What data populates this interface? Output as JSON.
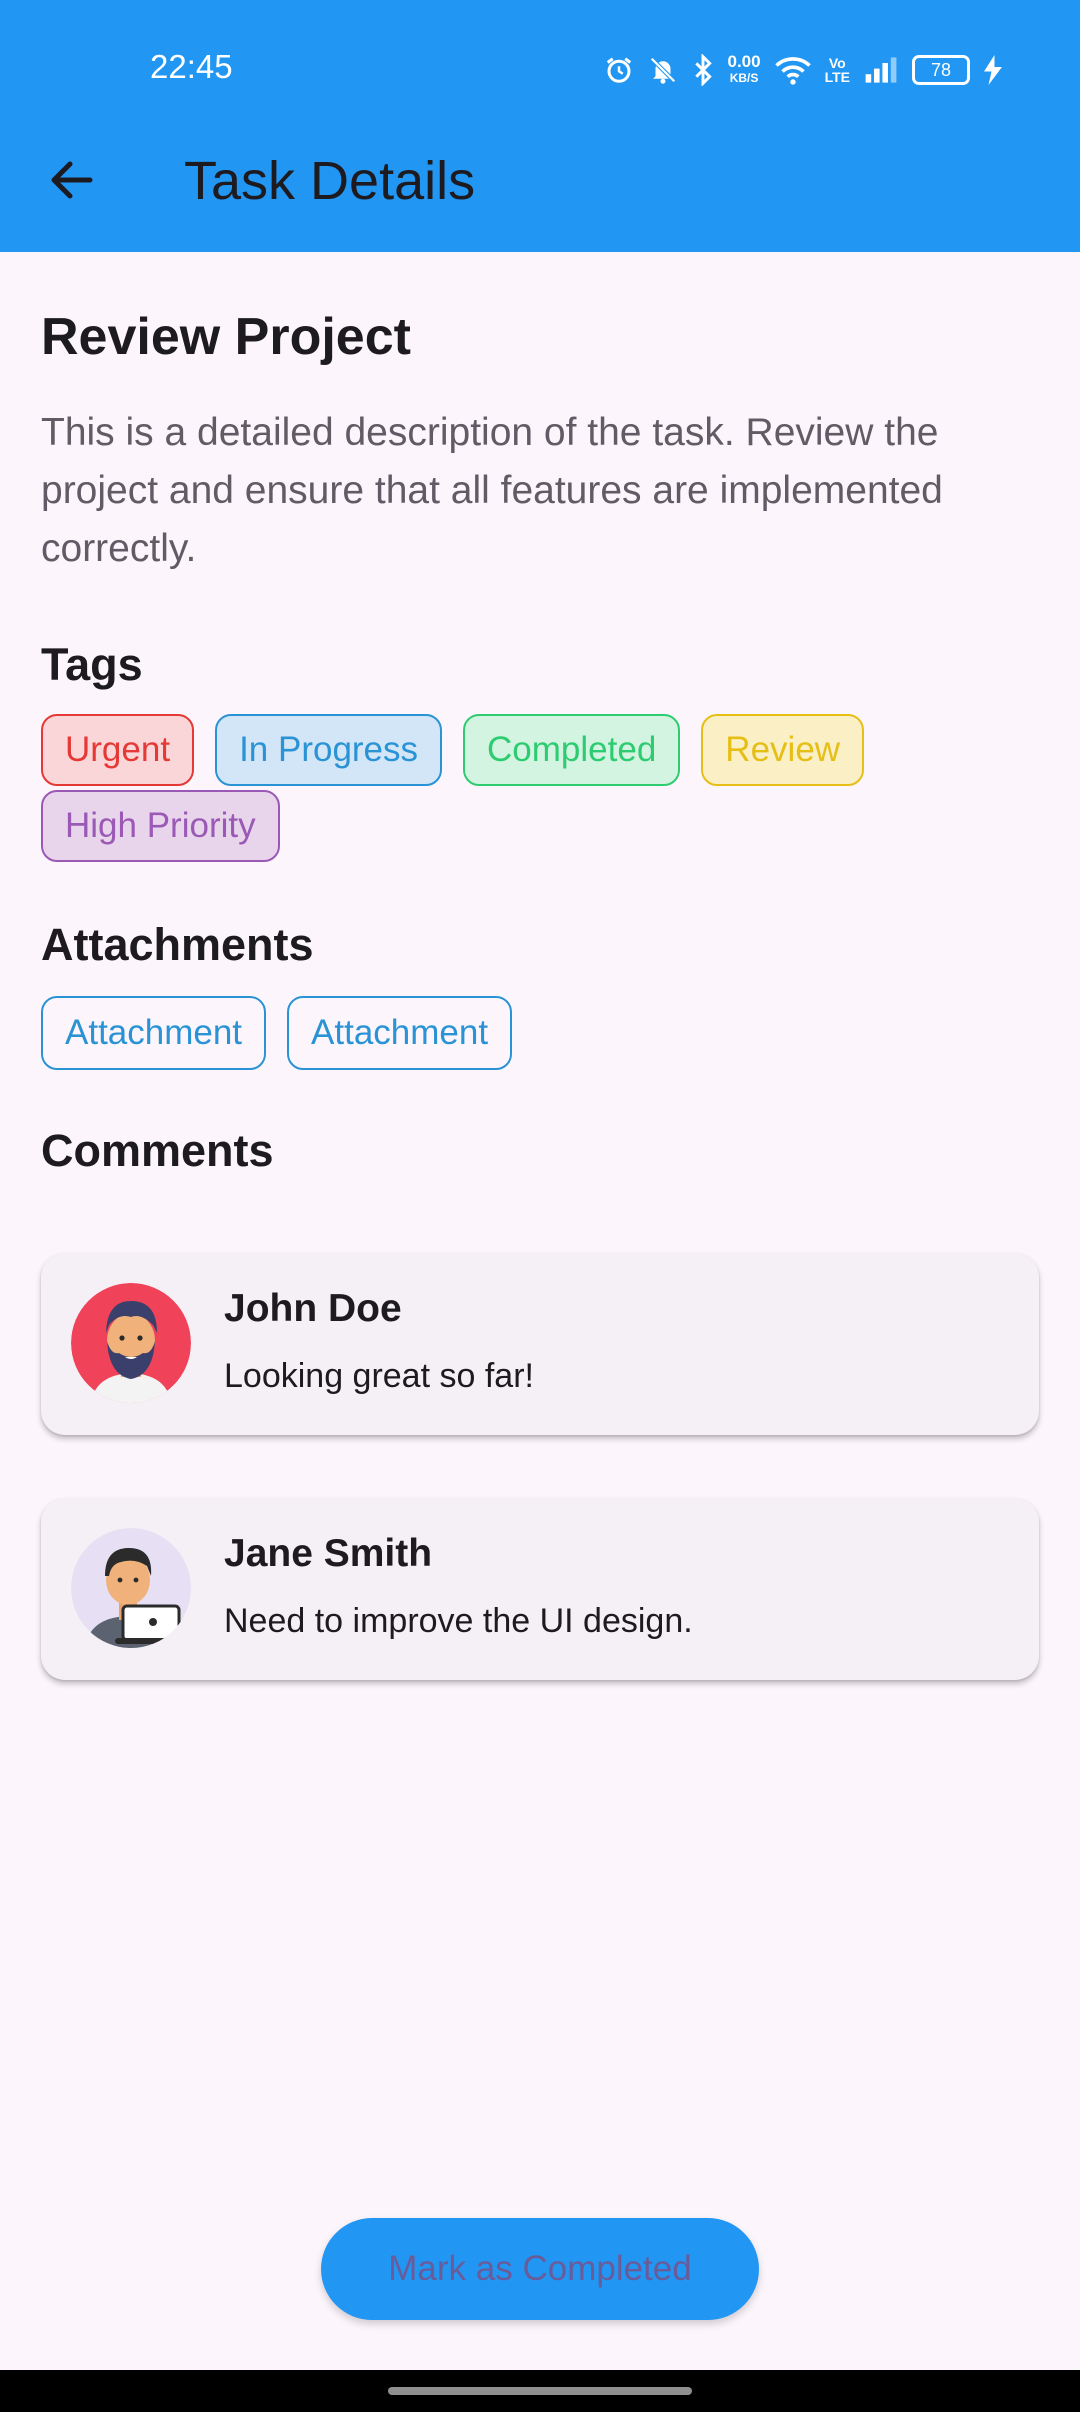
{
  "status_bar": {
    "time": "22:45",
    "net_speed_value": "0.00",
    "net_speed_unit": "KB/S",
    "volte_top": "Vo",
    "volte_bottom": "LTE",
    "battery_level": "78"
  },
  "app_bar": {
    "title": "Task Details",
    "back_icon": "arrow-back-icon",
    "background": "#2196f3"
  },
  "task": {
    "title": "Review Project",
    "description": "This is a detailed description of the task. Review the project and ensure that all features are implemented correctly."
  },
  "tags": {
    "heading": "Tags",
    "items": [
      {
        "label": "Urgent",
        "color": "#e53935",
        "bg": "#fad6d8"
      },
      {
        "label": "In Progress",
        "color": "#2a93d5",
        "bg": "#d2e6f7"
      },
      {
        "label": "Completed",
        "color": "#2ecc71",
        "bg": "#d3f4e1"
      },
      {
        "label": "Review",
        "color": "#e6bf16",
        "bg": "#fbefc6"
      },
      {
        "label": "High Priority",
        "color": "#9b59b6",
        "bg": "#e8d5ec"
      }
    ]
  },
  "attachments": {
    "heading": "Attachments",
    "items": [
      {
        "label": "Attachment"
      },
      {
        "label": "Attachment"
      }
    ]
  },
  "comments": {
    "heading": "Comments",
    "items": [
      {
        "name": "John Doe",
        "text": "Looking great so far!",
        "avatar": "bearded-man-avatar"
      },
      {
        "name": "Jane Smith",
        "text": "Need to improve the UI design.",
        "avatar": "person-with-laptop-avatar"
      }
    ]
  },
  "actions": {
    "complete_label": "Mark as Completed"
  }
}
